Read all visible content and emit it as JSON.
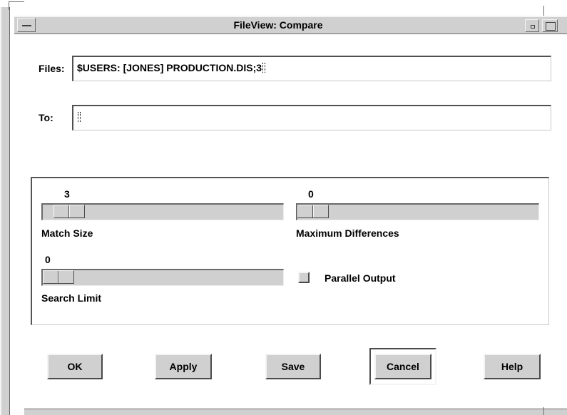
{
  "window": {
    "title": "FileView: Compare"
  },
  "files_field": {
    "label": "Files:",
    "value": "$USERS: [JONES] PRODUCTION.DIS;3"
  },
  "to_field": {
    "label": "To:",
    "value": ""
  },
  "options": {
    "match_size": {
      "label": "Match Size",
      "value": "3",
      "level": 0.05
    },
    "maximum_differences": {
      "label": "Maximum Differences",
      "value": "0",
      "level": 0.0
    },
    "search_limit": {
      "label": "Search Limit",
      "value": "0",
      "level": 0.0
    },
    "parallel_output": {
      "label": "Parallel Output",
      "checked": false
    }
  },
  "buttons": {
    "ok": "OK",
    "apply": "Apply",
    "save": "Save",
    "cancel": "Cancel",
    "help": "Help"
  },
  "colors": {
    "background": "#ffffff",
    "chrome": "#d0d0d0",
    "shadow": "#4a4a4a"
  }
}
